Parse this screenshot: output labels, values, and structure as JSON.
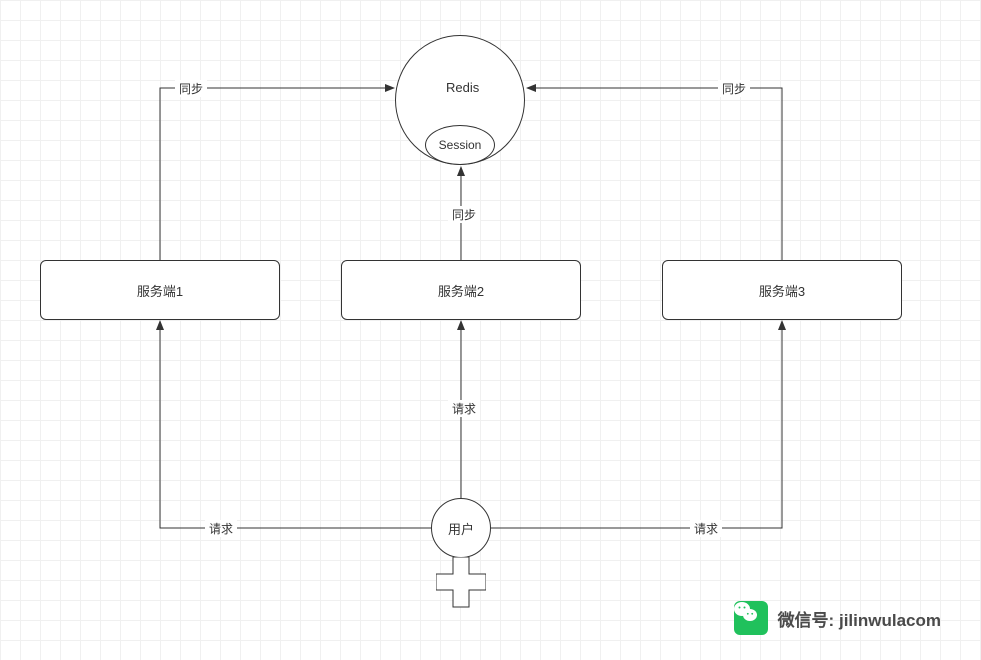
{
  "redis": {
    "label": "Redis",
    "session": "Session"
  },
  "servers": {
    "s1": "服务端1",
    "s2": "服务端2",
    "s3": "服务端3"
  },
  "user": "用户",
  "edges": {
    "sync1": "同步",
    "sync2": "同步",
    "sync3": "同步",
    "req1": "请求",
    "req2": "请求",
    "req3": "请求"
  },
  "watermark": {
    "prefix": "微信号:",
    "name": "jilinwulacom"
  }
}
